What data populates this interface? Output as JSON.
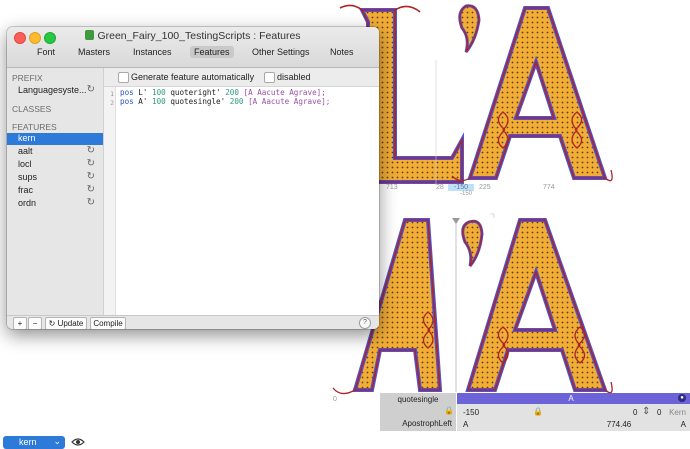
{
  "window": {
    "title": "Green_Fairy_100_TestingScripts : Features",
    "tabs": [
      {
        "label": "Font",
        "active": false
      },
      {
        "label": "Masters",
        "active": false
      },
      {
        "label": "Instances",
        "active": false
      },
      {
        "label": "Features",
        "active": true
      },
      {
        "label": "Other Settings",
        "active": false
      },
      {
        "label": "Notes",
        "active": false
      }
    ]
  },
  "sidebar": {
    "prefix_header": "PREFIX",
    "prefix_items": [
      {
        "label": "Languagesyste..."
      }
    ],
    "classes_header": "CLASSES",
    "features_header": "FEATURES",
    "features": [
      {
        "label": "kern",
        "selected": true
      },
      {
        "label": "aalt",
        "selected": false
      },
      {
        "label": "locl",
        "selected": false
      },
      {
        "label": "sups",
        "selected": false
      },
      {
        "label": "frac",
        "selected": false
      },
      {
        "label": "ordn",
        "selected": false
      }
    ]
  },
  "options": {
    "generate_label": "Generate feature automatically",
    "generate_checked": false,
    "disabled_label": "disabled",
    "disabled_checked": false
  },
  "code": {
    "line_numbers": [
      "1",
      "2"
    ],
    "lines": [
      {
        "kw": "pos",
        "g": "L'",
        "v": "100",
        "g2": "quoteright'",
        "v2": "200",
        "cls": "[A Aacute Agrave];"
      },
      {
        "kw": "pos",
        "g": "A'",
        "v": "100",
        "g2": "quotesingle'",
        "v2": "200",
        "cls": "[A Aacute Agrave];"
      }
    ]
  },
  "footer": {
    "add_label": "+",
    "remove_label": "−",
    "update_label": "Update",
    "compile_label": "Compile",
    "help_label": "?"
  },
  "canvas": {
    "metrics_top": [
      "713",
      "28",
      "-150",
      "-150",
      "225",
      "774"
    ],
    "metrics_bottom": [
      "0"
    ]
  },
  "info_panel": {
    "left_glyph": "quotesingle",
    "left_group": "ApostrophLeft",
    "right_glyph": "A",
    "kern_value": "-150",
    "zero1": "0",
    "zero2": "0",
    "kern_label": "Kern",
    "group_left": "A",
    "width": "774.46",
    "group_right": "A"
  },
  "bottom": {
    "feature_select": "kern"
  },
  "colors": {
    "glyph_fill": "#f2ad35",
    "glyph_stroke": "#ad2424",
    "glyph_inner": "#4a55d9",
    "selection": "#2d7ad9",
    "info_bar": "#6c63d8"
  }
}
